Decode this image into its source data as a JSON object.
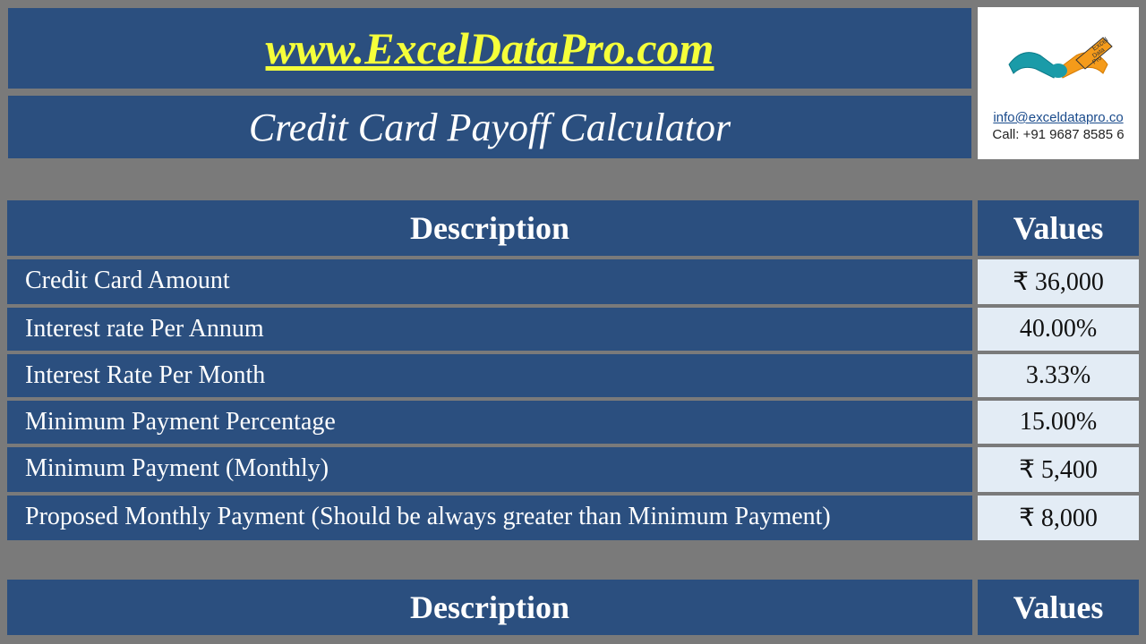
{
  "header": {
    "url": "www.ExcelDataPro.com",
    "title": "Credit Card Payoff Calculator"
  },
  "contact": {
    "email": "info@exceldatapro.co",
    "phone": "Call: +91 9687 8585 6"
  },
  "table1": {
    "headers": {
      "description": "Description",
      "values": "Values"
    },
    "rows": [
      {
        "desc": "Credit Card Amount",
        "value": "₹ 36,000"
      },
      {
        "desc": "Interest rate Per Annum",
        "value": "40.00%"
      },
      {
        "desc": "Interest Rate Per Month",
        "value": "3.33%"
      },
      {
        "desc": "Minimum Payment Percentage",
        "value": "15.00%"
      },
      {
        "desc": "Minimum Payment (Monthly)",
        "value": "₹ 5,400"
      },
      {
        "desc": "Proposed Monthly Payment (Should be always greater than Minimum Payment)",
        "value": "₹ 8,000"
      }
    ]
  },
  "table2": {
    "headers": {
      "description": "Description",
      "values": "Values"
    }
  }
}
